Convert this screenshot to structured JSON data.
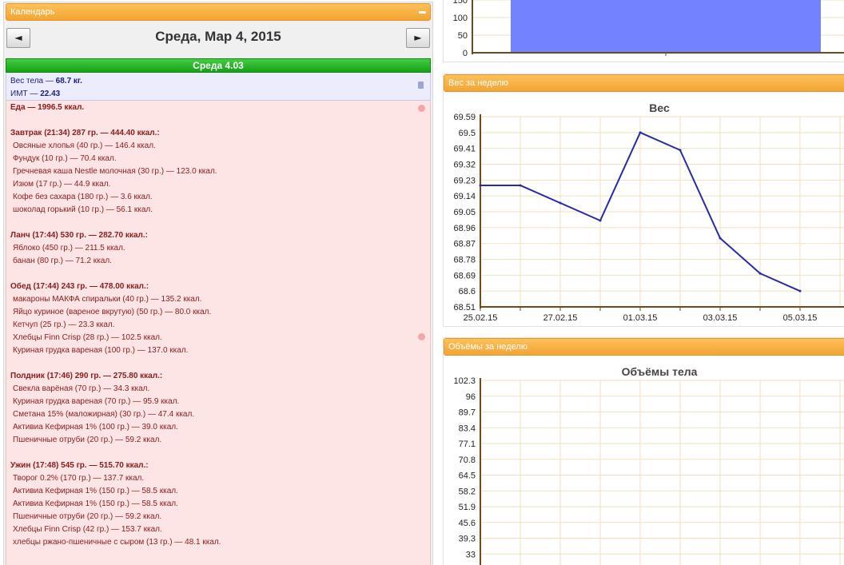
{
  "calendar": {
    "header_label": "Календарь",
    "prev_label": "◄",
    "next_label": "►",
    "date_title": "Среда, Мар 4, 2015",
    "day_bar": "Среда 4.03",
    "weight_prefix": "Вес тела — ",
    "weight_value": "68.7 кг.",
    "bmi_prefix": "ИМТ — ",
    "bmi_value": "22.43",
    "food_lines": [
      {
        "text": "Еда — 1996.5 ккал.",
        "bold": true
      },
      {
        "text": "",
        "gap": true
      },
      {
        "text": "Завтрак (21:34) 287 гр. — 444.40 ккал.:",
        "bold": true
      },
      {
        "text": "Овсяные хлопья (40 гр.) — 146.4 ккал.",
        "item": true
      },
      {
        "text": "Фундук (10 гр.) — 70.4 ккал.",
        "item": true
      },
      {
        "text": "Гречневая каша Nestle молочная (30 гр.) — 123.0 ккал.",
        "item": true
      },
      {
        "text": "Изюм (17 гр.) — 44.9 ккал.",
        "item": true
      },
      {
        "text": "Кофе без сахара (180 гр.) — 3.6 ккал.",
        "item": true
      },
      {
        "text": "шоколад горький (10 гр.) — 56.1 ккал.",
        "item": true
      },
      {
        "text": "",
        "gap": true
      },
      {
        "text": "Ланч (17:44) 530 гр. — 282.70 ккал.:",
        "bold": true
      },
      {
        "text": "Яблоко (450 гр.) — 211.5 ккал.",
        "item": true
      },
      {
        "text": "банан (80 гр.) — 71.2 ккал.",
        "item": true
      },
      {
        "text": "",
        "gap": true
      },
      {
        "text": "Обед (17:44) 243 гр. — 478.00 ккал.:",
        "bold": true
      },
      {
        "text": "макароны МАКФА спиральки (40 гр.) — 135.2 ккал.",
        "item": true
      },
      {
        "text": "Яйцо куриное (вареное вкрутую) (50 гр.) — 80.0 ккал.",
        "item": true
      },
      {
        "text": "Кетчуп (25 гр.) — 23.3 ккал.",
        "item": true
      },
      {
        "text": "Хлебцы Finn Crisp (28 гр.) — 102.5 ккал.",
        "item": true
      },
      {
        "text": "Куриная грудка вареная (100 гр.) — 137.0 ккал.",
        "item": true
      },
      {
        "text": "",
        "gap": true
      },
      {
        "text": "Полдник (17:46) 290 гр. — 275.80 ккал.:",
        "bold": true
      },
      {
        "text": "Свекла варёная (70 гр.) — 34.3 ккал.",
        "item": true
      },
      {
        "text": "Куриная грудка вареная (70 гр.) — 95.9 ккал.",
        "item": true
      },
      {
        "text": "Сметана 15% (маложирная) (30 гр.) — 47.4 ккал.",
        "item": true
      },
      {
        "text": "Активиа Кефирная 1% (100 гр.) — 39.0 ккал.",
        "item": true
      },
      {
        "text": "Пшеничные отруби (20 гр.) — 59.2 ккал.",
        "item": true
      },
      {
        "text": "",
        "gap": true
      },
      {
        "text": "Ужин (17:48) 545 гр. — 515.70 ккал.:",
        "bold": true
      },
      {
        "text": "Творог 0.2% (170 гр.) — 137.7 ккал.",
        "item": true
      },
      {
        "text": "Активиа Кефирная 1% (150 гр.) — 58.5 ккал.",
        "item": true
      },
      {
        "text": "Активиа Кефирная 1% (150 гр.) — 58.5 ккал.",
        "item": true
      },
      {
        "text": "Пшеничные отруби (20 гр.) — 59.2 ккал.",
        "item": true
      },
      {
        "text": "Хлебцы Finn Crisp (42 гр.) — 153.7 ккал.",
        "item": true
      },
      {
        "text": "хлебцы ржано-пшеничные с сыром (13 гр.) — 48.1 ккал.",
        "item": true
      }
    ]
  },
  "weight_panel": {
    "header_label": "Вес за неделю"
  },
  "volume_panel": {
    "header_label": "Объёмы за неделю"
  },
  "colors": {
    "line": "#2a2aa6",
    "bar": "#7383ff",
    "grid": "#efe2bd",
    "axis": "#6e4a1e",
    "header": "#f3a433"
  },
  "chart_data": [
    {
      "type": "bar",
      "y_ticks": [
        "0",
        "50",
        "100",
        "150"
      ],
      "values": [
        175
      ],
      "ylim": [
        0,
        150
      ]
    },
    {
      "type": "line",
      "title": "Вес",
      "x": [
        "25.02.15",
        "26.02.15",
        "27.02.15",
        "28.02.15",
        "01.03.15",
        "02.03.15",
        "03.03.15",
        "04.03.15",
        "05.03.15"
      ],
      "x_tick_labels": [
        "25.02.15",
        "27.02.15",
        "01.03.15",
        "03.03.15",
        "05.03.15"
      ],
      "y": [
        69.2,
        69.2,
        69.1,
        69.0,
        69.5,
        69.4,
        68.9,
        68.7,
        68.6
      ],
      "y_ticks": [
        "68.51",
        "68.6",
        "68.69",
        "68.78",
        "68.87",
        "68.96",
        "69.05",
        "69.14",
        "69.23",
        "69.32",
        "69.41",
        "69.5",
        "69.59"
      ],
      "ylim": [
        68.51,
        69.59
      ],
      "grid": true
    },
    {
      "type": "line",
      "title": "Объёмы тела",
      "y_ticks": [
        "33",
        "39.3",
        "45.6",
        "51.9",
        "58.2",
        "64.5",
        "70.8",
        "77.1",
        "83.4",
        "89.7",
        "96",
        "102.3"
      ],
      "ylim": [
        26.7,
        102.3
      ],
      "grid": true
    }
  ]
}
